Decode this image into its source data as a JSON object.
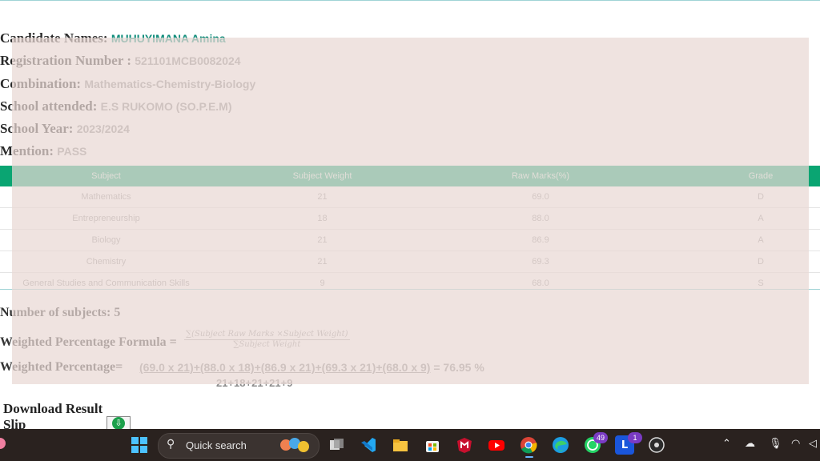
{
  "candidate": {
    "name_label": "Candidate Names:",
    "name_value": "MUHUYIMANA Amina",
    "reg_label": "Registration Number :",
    "reg_value": "521101MCB0082024",
    "comb_label": "Combination:",
    "comb_value": "Mathematics-Chemistry-Biology",
    "school_label": "School attended:",
    "school_value": "E.S RUKOMO (SO.P.E.M)",
    "year_label": "School Year:",
    "year_value": "2023/2024",
    "mention_label": "Mention:",
    "mention_value": "PASS"
  },
  "table": {
    "headers": [
      "Subject",
      "Subject Weight",
      "Raw Marks(%)",
      "Grade"
    ],
    "rows": [
      [
        "Mathematics",
        "21",
        "69.0",
        "D"
      ],
      [
        "Entrepreneurship",
        "18",
        "88.0",
        "A"
      ],
      [
        "Biology",
        "21",
        "86.9",
        "A"
      ],
      [
        "Chemistry",
        "21",
        "69.3",
        "D"
      ],
      [
        "General Studies and Communication Skills",
        "9",
        "68.0",
        "S"
      ]
    ]
  },
  "summary": {
    "num_subjects_label": "Number of subjects:",
    "num_subjects_value": "5",
    "formula_label": "Weighted Percentage Formula =",
    "formula_numerator": "∑(Subject Raw Marks ×Subject Weight)",
    "formula_denominator": "∑Subject Weight",
    "wp_label": "Weighted Percentage=",
    "wp_numerator": "(69.0 x 21)+(88.0 x 18)+(86.9 x 21)+(69.3 x 21)+(68.0 x 9)",
    "wp_result": "= 76.95 %",
    "wp_denominator": "21+18+21+21+9"
  },
  "download": {
    "label": "Download Result Slip"
  },
  "taskbar": {
    "search_placeholder": "Quick search",
    "whatsapp_badge": "49",
    "l_badge": "1"
  }
}
